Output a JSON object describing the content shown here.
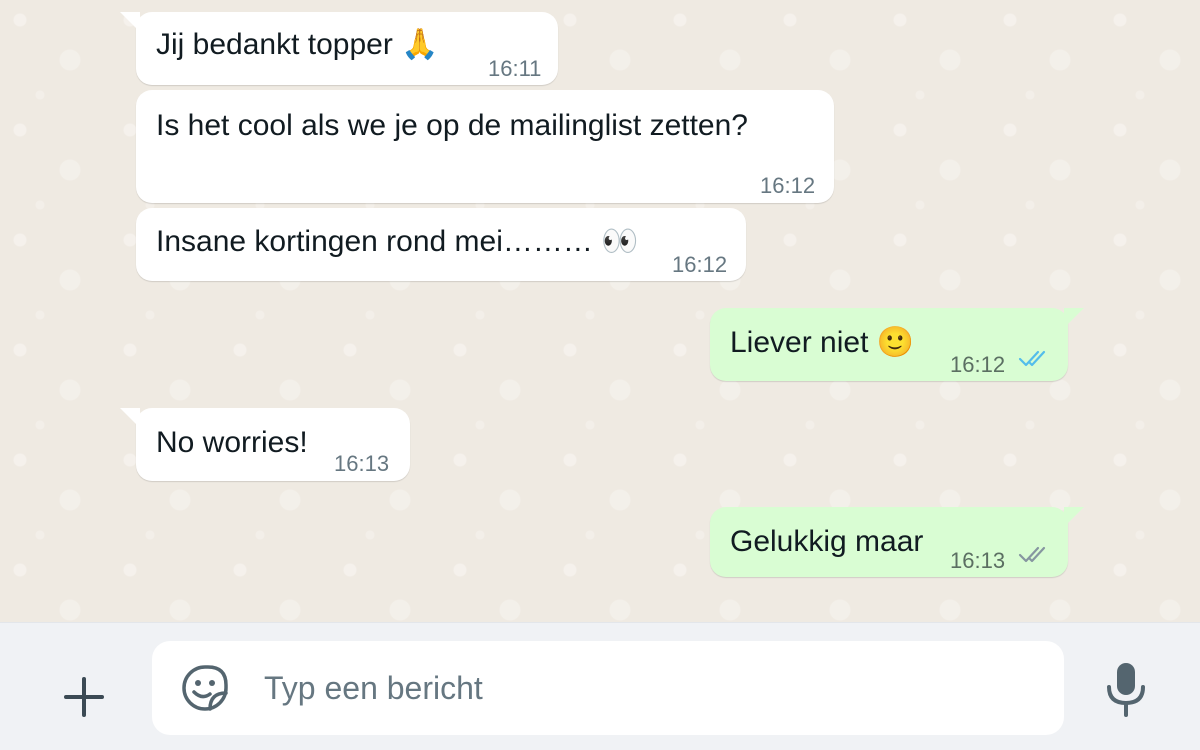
{
  "messages": [
    {
      "direction": "incoming",
      "text": "Jij bedankt topper",
      "emoji": "🙏",
      "emoji_name": "folded-hands",
      "time": "16:11"
    },
    {
      "direction": "incoming",
      "text": "Is het cool als we je op de mailinglist zetten?",
      "time": "16:12"
    },
    {
      "direction": "incoming",
      "text": "Insane kortingen rond mei………",
      "emoji": "👀",
      "emoji_name": "eyes",
      "time": "16:12"
    },
    {
      "direction": "outgoing",
      "text": "Liever niet",
      "emoji": "🙂",
      "emoji_name": "slightly-smiling-face",
      "time": "16:12",
      "status": "read",
      "tick_color": "#53bdeb"
    },
    {
      "direction": "incoming",
      "text": "No worries!",
      "time": "16:13"
    },
    {
      "direction": "outgoing",
      "text": "Gelukkig maar",
      "time": "16:13",
      "status": "delivered",
      "tick_color": "#8696a0"
    }
  ],
  "composer": {
    "placeholder": "Typ een bericht",
    "value": "",
    "left_icon": "plus-icon",
    "sticker_icon": "sticker-icon",
    "right_icon": "microphone-icon"
  },
  "colors": {
    "chat_background": "#efeae2",
    "incoming_bubble": "#ffffff",
    "outgoing_bubble": "#d9fdd3",
    "composer_background": "#f0f2f5",
    "icon_gray": "#54656f"
  }
}
